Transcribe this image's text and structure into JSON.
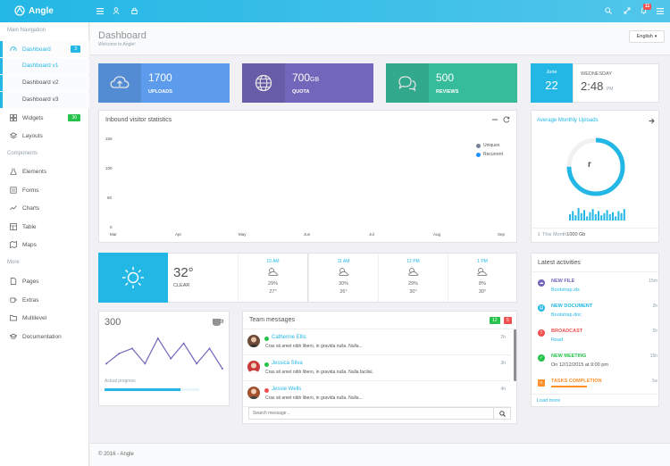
{
  "app": {
    "brand": "Angle"
  },
  "topbar": {
    "notification_count": "11"
  },
  "sidebar": {
    "heading_main": "Main Navigation",
    "heading_components": "Components",
    "heading_more": "More",
    "dashboard": {
      "label": "Dashboard",
      "badge": "3"
    },
    "dashboard_subs": [
      "Dashboard v1",
      "Dashboard v2",
      "Dashboard v3"
    ],
    "widgets": {
      "label": "Widgets",
      "badge": "30"
    },
    "layouts": "Layouts",
    "elements": "Elements",
    "forms": "Forms",
    "charts": "Charts",
    "table": "Table",
    "maps": "Maps",
    "pages": "Pages",
    "extras": "Extras",
    "multilevel": "Multilevel",
    "documentation": "Documentation"
  },
  "header": {
    "title": "Dashboard",
    "subtitle": "Welcome to Angle!",
    "language": "English"
  },
  "stats": [
    {
      "value": "1700",
      "unit": "",
      "label": "UPLOADS",
      "color": "#5d9cec"
    },
    {
      "value": "700",
      "unit": "GB",
      "label": "QUOTA",
      "color": "#7266ba"
    },
    {
      "value": "500",
      "unit": "",
      "label": "REVIEWS",
      "color": "#37bc9b"
    }
  ],
  "date": {
    "month": "June",
    "day": "22",
    "weekday": "WEDNESDAY",
    "time": "2:48",
    "ampm": "PM"
  },
  "inbound": {
    "title": "Inbound visitor statistics",
    "legend": [
      {
        "name": "Uniques",
        "color": "#768294"
      },
      {
        "name": "Recurrent",
        "color": "#1f92fe"
      }
    ],
    "y_ticks": [
      "150",
      "100",
      "50",
      "0"
    ],
    "x_ticks": [
      "Mar",
      "Apr",
      "May",
      "Jun",
      "Jul",
      "Aug",
      "Sep"
    ]
  },
  "uploads": {
    "title": "Average Monthly Uploads",
    "center": "r",
    "progress": 0.75,
    "footer_prefix": "This Month",
    "footer_value": "1000 Gb",
    "bars": [
      6,
      9,
      5,
      12,
      7,
      10,
      4,
      8,
      11,
      6,
      9,
      5,
      7,
      10,
      6,
      8,
      4,
      9,
      7,
      11
    ]
  },
  "weather": {
    "temp": "32°",
    "condition": "CLEAR",
    "hours": [
      {
        "time": "10 AM",
        "humidity": "29%",
        "temp": "27°"
      },
      {
        "time": "11 AM",
        "humidity": "30%",
        "temp": "26°"
      },
      {
        "time": "12 PM",
        "humidity": "29%",
        "temp": "30°"
      },
      {
        "time": "1 PM",
        "humidity": "8%",
        "temp": "30°"
      }
    ]
  },
  "progress_card": {
    "value": "300",
    "label": "Actual progress",
    "progress": 0.8,
    "sparkline": [
      3,
      5,
      6,
      3,
      8,
      4,
      7,
      3,
      6,
      2
    ]
  },
  "messages": {
    "title": "Team messages",
    "badge_green": "12",
    "badge_red": "5",
    "items": [
      {
        "name": "Catherine Ellis",
        "text": "Cras sit amet nibh libero, in gravida nulla. Nulla...",
        "time": "2h",
        "status": "#27c24c"
      },
      {
        "name": "Jessica Silva",
        "text": "Cras sit amet nibh libero, in gravida nulla. Nulla facilisi.",
        "time": "3h",
        "status": "#27c24c"
      },
      {
        "name": "Jessie Wells",
        "text": "Cras sit amet nibh libero, in gravida nulla. Nulla...",
        "time": "4h",
        "status": "#f05050"
      }
    ],
    "search_placeholder": "Search message .."
  },
  "activities": {
    "title": "Latest activities",
    "items": [
      {
        "title": "NEW FILE",
        "sub": "Bootstrap.xls",
        "time": "15m",
        "color": "#7266ba",
        "title_color": "#7266ba",
        "sub_color": "#23b7e5",
        "icon": "cloud-icon"
      },
      {
        "title": "NEW DOCUMENT",
        "sub": "Bootstrap.doc",
        "time": "2h",
        "color": "#23b7e5",
        "title_color": "#23b7e5",
        "sub_color": "#23b7e5",
        "icon": "document-icon"
      },
      {
        "title": "BROADCAST",
        "sub": "Read",
        "time": "5h",
        "color": "#f05050",
        "title_color": "#f05050",
        "sub_color": "#23b7e5",
        "icon": "alert-icon"
      },
      {
        "title": "NEW MEETING",
        "sub": "On 12/12/2015 at 9:00 pm",
        "time": "15h",
        "color": "#27c24c",
        "title_color": "#27c24c",
        "sub_color": "#515253",
        "icon": "check-icon"
      },
      {
        "title": "TASKS COMPLETION",
        "sub": "",
        "time": "1w",
        "color": "#ff902b",
        "title_color": "#ff902b",
        "sub_color": "#515253",
        "icon": "tasks-icon"
      }
    ],
    "load_more": "Load more"
  },
  "footer": {
    "text": "© 2016 - Angle"
  }
}
